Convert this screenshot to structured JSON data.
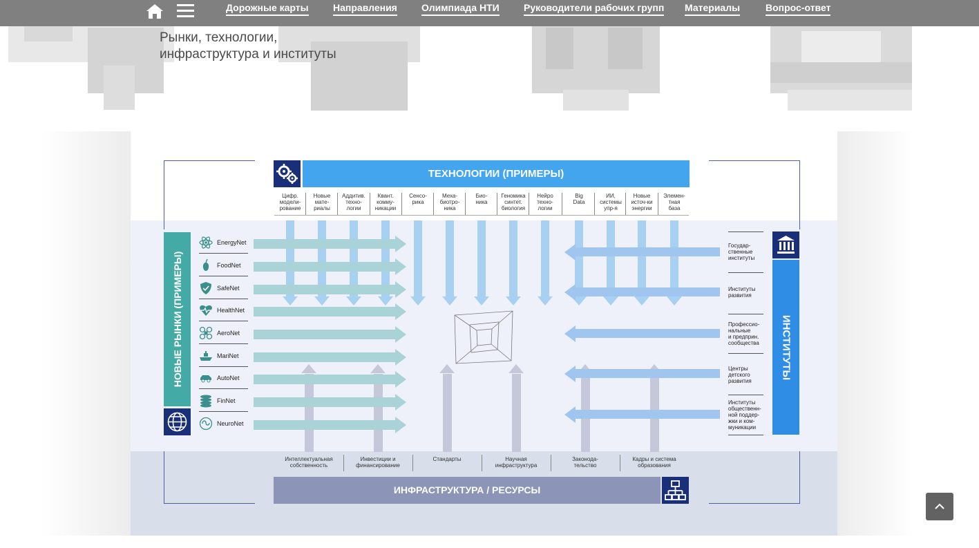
{
  "nav": {
    "links": [
      "Дорожные карты",
      "Направления",
      "Олимпиада НТИ",
      "Руководители рабочих групп",
      "Материалы",
      "Вопрос-ответ"
    ],
    "icons": [
      "home-icon",
      "menu-icon"
    ]
  },
  "hero": {
    "subtitle_line1": "Рынки, технологии,",
    "subtitle_line2": "инфраструктура и институты"
  },
  "diagram": {
    "tech_title": "ТЕХНОЛОГИИ (ПРИМЕРЫ)",
    "tech_columns": [
      "Цифр.\nмодели-\nрование",
      "Новые\nмате-\nриалы",
      "Аддитив.\nтехно-\nлогии",
      "Квант.\nкоммy-\nникации",
      "Сенсо-\nрика",
      "Меха-\nбиотро-\nника",
      "Био-\nника",
      "Геномика\nсинтет.\nбиология",
      "Нейро\nтехно-\nлогии",
      "Big\nData",
      "ИИ,\nсистемы\nупр-я",
      "Новые\nисточ-ки\nэнергии",
      "Элемен-\nтная\nбаза"
    ],
    "markets_title": "НОВЫЕ РЫНКИ (ПРИМЕРЫ)",
    "markets": [
      {
        "label": "EnergyNet",
        "icon": "atom-icon"
      },
      {
        "label": "FoodNet",
        "icon": "fruit-icon"
      },
      {
        "label": "SafeNet",
        "icon": "shield-icon"
      },
      {
        "label": "HealthNet",
        "icon": "heart-icon"
      },
      {
        "label": "AeroNet",
        "icon": "drone-icon"
      },
      {
        "label": "MariNet",
        "icon": "ship-icon"
      },
      {
        "label": "AutoNet",
        "icon": "car-icon"
      },
      {
        "label": "FinNet",
        "icon": "coins-icon"
      },
      {
        "label": "NeuroNet",
        "icon": "brain-icon"
      }
    ],
    "institutes_title": "ИНСТИТУТЫ",
    "institutes": [
      "Государ-\nственные\nинституты",
      "Институты\nразвития",
      "Профессио-\nнальные\nи предприн.\nсообщества",
      "Центры\nдетского\nразвития",
      "Институты\nобщественн-\nной поддер-\nжки и ком-\nмуникации"
    ],
    "infra_title": "ИНФРАСТРУКТУРА / РЕСУРСЫ",
    "infra_columns": [
      "Интеллектуальная\nсобственность",
      "Инвестиции и\nфинансирование",
      "Стандарты",
      "Научная\nинфраструктура",
      "Законода-\nтельство",
      "Кадры и система\nобразования"
    ]
  },
  "colors": {
    "nav_bg": "#808080",
    "tech_blue": "#42a5ee",
    "markets_teal": "#43aaa6",
    "institutes_blue": "#2f8de6",
    "infra_grey": "#8c95b8",
    "icon_navy": "#1a2f7a"
  },
  "scroll_top": {
    "icon": "chevron-up-icon"
  }
}
